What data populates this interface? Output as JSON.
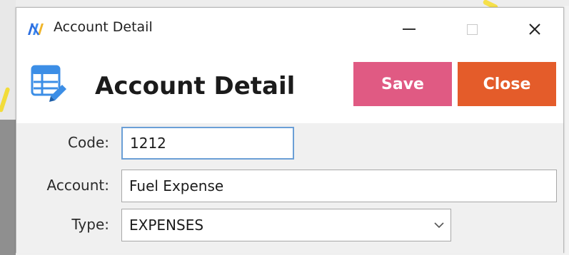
{
  "window": {
    "title": "Account Detail"
  },
  "header": {
    "heading": "Account Detail",
    "save_label": "Save",
    "close_label": "Close"
  },
  "form": {
    "code_label": "Code:",
    "code_value": "1212",
    "account_label": "Account:",
    "account_value": "Fuel Expense",
    "type_label": "Type:",
    "type_value": "EXPENSES"
  },
  "colors": {
    "save_button": "#e05a83",
    "close_button": "#e45c2a",
    "focus_border": "#6b9fd6"
  },
  "icons": {
    "app": "app-logo-icon",
    "table": "table-edit-icon",
    "minimize": "minimize-icon",
    "maximize": "maximize-icon",
    "close": "close-icon",
    "dropdown": "chevron-down-icon"
  }
}
